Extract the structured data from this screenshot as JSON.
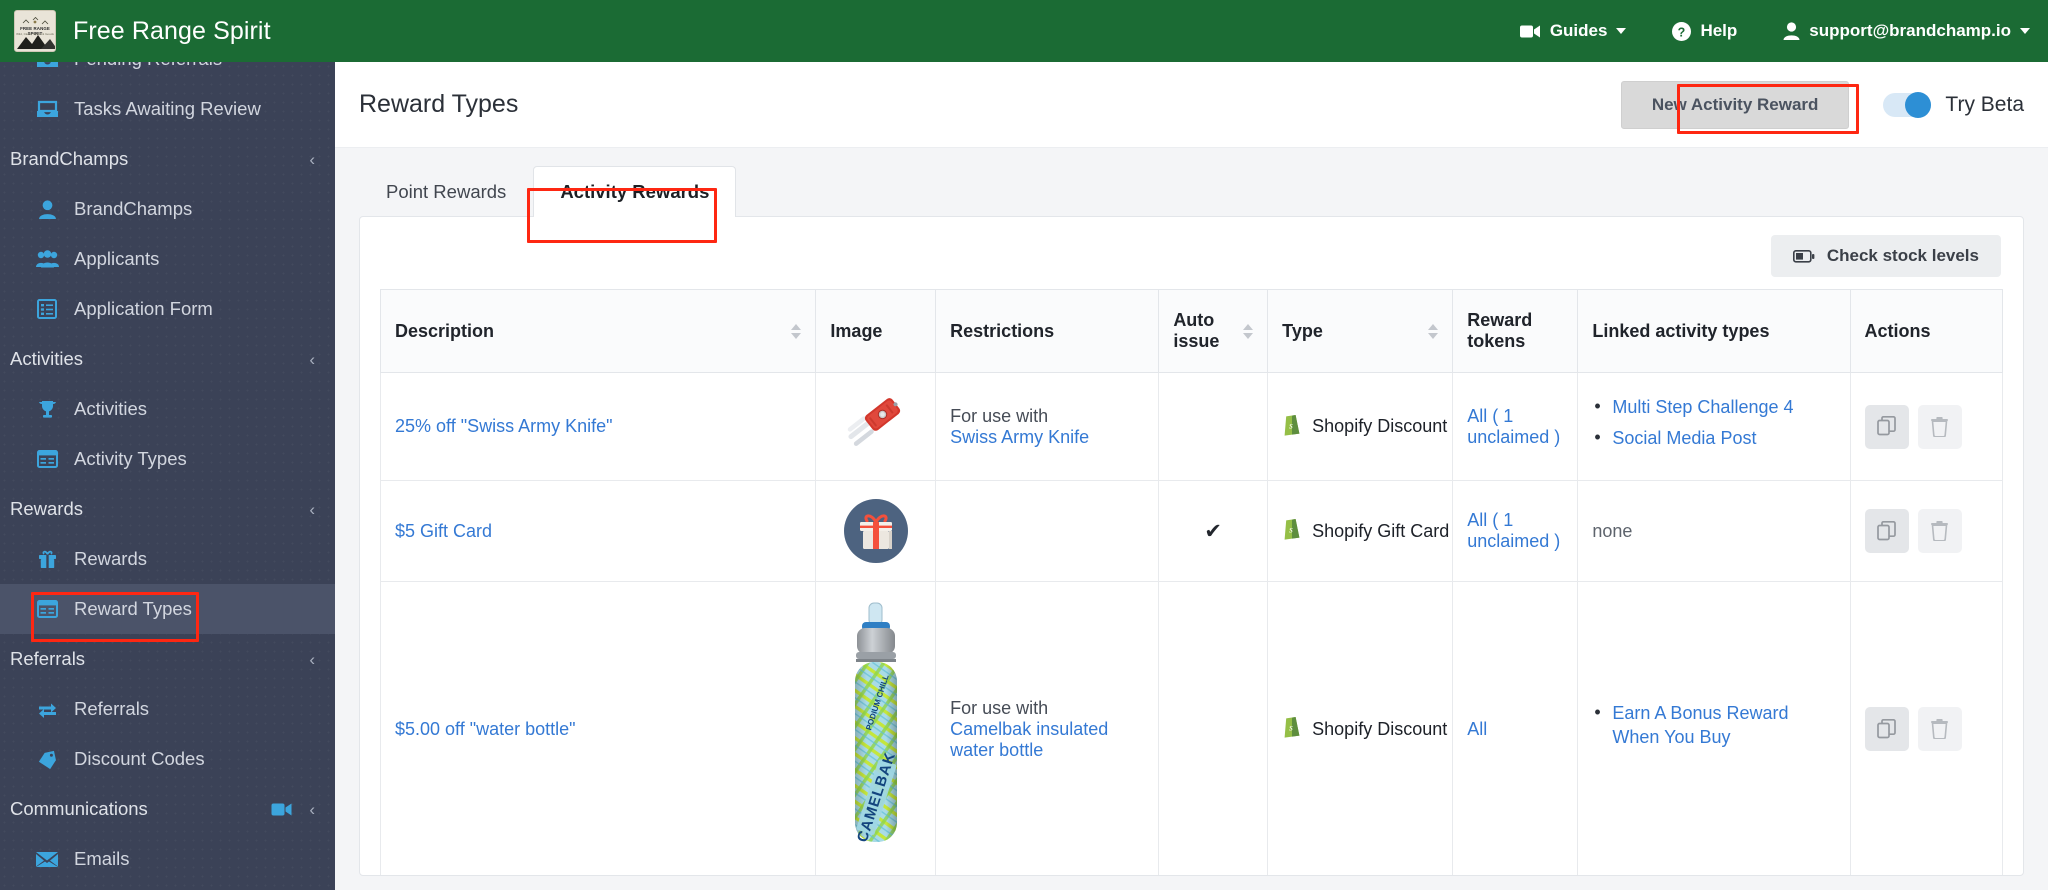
{
  "topbar": {
    "brand_title": "Free Range Spirit",
    "logo_text": "FREE RANGE SPIRIT",
    "logo_subtext": "Wild, Clean, Spirits & Goods",
    "nav": [
      {
        "label": "Guides",
        "icon": "video-camera-icon",
        "caret": true
      },
      {
        "label": "Help",
        "icon": "question-circle-icon",
        "caret": false
      },
      {
        "label": "support@brandchamp.io",
        "icon": "user-icon",
        "caret": true
      }
    ],
    "brand_color": "#1b6b34"
  },
  "sidebar": {
    "bg_color": "#3b4257",
    "accent_color": "#3ca5dd",
    "items": [
      {
        "type": "link",
        "label": "Pending Referrals",
        "icon": "inbox-icon",
        "active": false,
        "clipped": true
      },
      {
        "type": "link",
        "label": "Tasks Awaiting Review",
        "icon": "inbox-icon",
        "active": false
      },
      {
        "type": "group",
        "label": "BrandChamps",
        "chevron": "‹"
      },
      {
        "type": "link",
        "label": "BrandChamps",
        "icon": "user-icon",
        "active": false
      },
      {
        "type": "link",
        "label": "Applicants",
        "icon": "users-icon",
        "active": false
      },
      {
        "type": "link",
        "label": "Application Form",
        "icon": "form-icon",
        "active": false
      },
      {
        "type": "group",
        "label": "Activities",
        "chevron": "‹"
      },
      {
        "type": "link",
        "label": "Activities",
        "icon": "trophy-icon",
        "active": false
      },
      {
        "type": "link",
        "label": "Activity Types",
        "icon": "table-icon",
        "active": false
      },
      {
        "type": "group",
        "label": "Rewards",
        "chevron": "‹"
      },
      {
        "type": "link",
        "label": "Rewards",
        "icon": "gift-icon",
        "active": false
      },
      {
        "type": "link",
        "label": "Reward Types",
        "icon": "table-icon",
        "active": true
      },
      {
        "type": "group",
        "label": "Referrals",
        "chevron": "‹"
      },
      {
        "type": "link",
        "label": "Referrals",
        "icon": "retweet-icon",
        "active": false
      },
      {
        "type": "link",
        "label": "Discount Codes",
        "icon": "tag-icon",
        "active": false
      },
      {
        "type": "group",
        "label": "Communications",
        "chevron": "‹",
        "video": true
      },
      {
        "type": "link",
        "label": "Emails",
        "icon": "envelope-icon",
        "active": false
      }
    ]
  },
  "page": {
    "title": "Reward Types",
    "new_button": "New Activity Reward",
    "beta_label": "Try Beta",
    "beta_on": true,
    "tabs": [
      {
        "label": "Point Rewards",
        "active": false
      },
      {
        "label": "Activity Rewards",
        "active": true
      }
    ],
    "stock_button": "Check stock levels"
  },
  "table": {
    "columns": [
      {
        "label": "Description",
        "sortable": true
      },
      {
        "label": "Image",
        "sortable": false
      },
      {
        "label": "Restrictions",
        "sortable": false
      },
      {
        "label": "Auto issue",
        "sortable": true
      },
      {
        "label": "Type",
        "sortable": true
      },
      {
        "label": "Reward tokens",
        "sortable": false
      },
      {
        "label": "Linked activity types",
        "sortable": false
      },
      {
        "label": "Actions",
        "sortable": false
      }
    ],
    "rows": [
      {
        "description": "25% off \"Swiss Army Knife\"",
        "image": "swiss-army-knife-photo",
        "restriction_label": "For use with",
        "restriction_link": "Swiss Army Knife",
        "auto_issue": "",
        "type": "Shopify Discount",
        "tokens_all": "All",
        "tokens_detail": "( 1 unclaimed )",
        "linked": [
          "Multi Step Challenge 4",
          "Social Media Post"
        ],
        "linked_none": ""
      },
      {
        "description": "$5 Gift Card",
        "image": "gift-box-icon",
        "restriction_label": "",
        "restriction_link": "",
        "auto_issue": "✔",
        "type": "Shopify Gift Card",
        "tokens_all": "All",
        "tokens_detail": "( 1 unclaimed )",
        "linked": [],
        "linked_none": "none"
      },
      {
        "description": "$5.00 off \"water bottle\"",
        "image": "camelbak-water-bottle-photo",
        "restriction_label": "For use with",
        "restriction_link": "Camelbak insulated water bottle",
        "auto_issue": "",
        "type": "Shopify Discount",
        "tokens_all": "All",
        "tokens_detail": "",
        "linked": [
          "Earn A Bonus Reward When You Buy"
        ],
        "linked_none": ""
      }
    ],
    "action_icons": [
      "copy-icon",
      "trash-icon"
    ]
  },
  "annotations": {
    "color": "#fe2712",
    "boxes": [
      "reward-types-sidebar-item",
      "new-activity-reward-button",
      "activity-rewards-tab"
    ]
  }
}
